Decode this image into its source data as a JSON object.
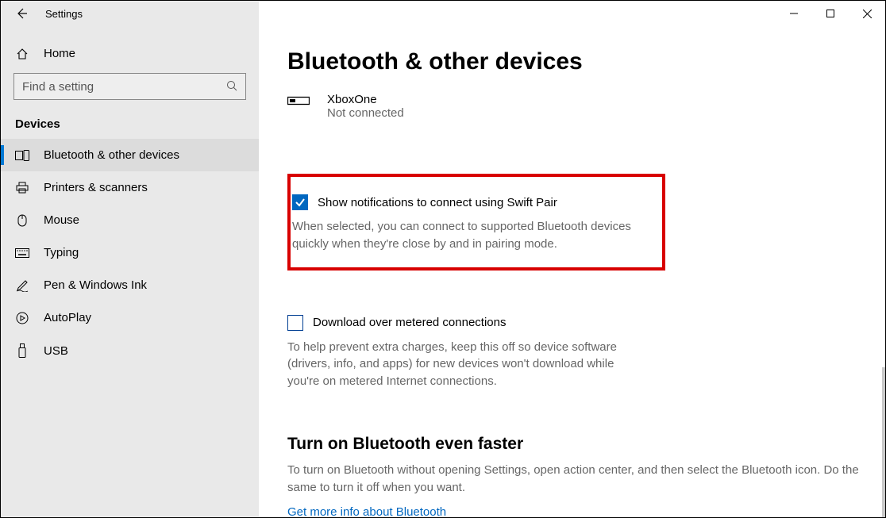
{
  "titlebar": {
    "title": "Settings"
  },
  "sidebar": {
    "home_label": "Home",
    "search_placeholder": "Find a setting",
    "section_label": "Devices",
    "items": [
      {
        "label": "Bluetooth & other devices"
      },
      {
        "label": "Printers & scanners"
      },
      {
        "label": "Mouse"
      },
      {
        "label": "Typing"
      },
      {
        "label": "Pen & Windows Ink"
      },
      {
        "label": "AutoPlay"
      },
      {
        "label": "USB"
      }
    ]
  },
  "content": {
    "page_title": "Bluetooth & other devices",
    "device": {
      "name": "XboxOne",
      "status": "Not connected"
    },
    "swift_pair": {
      "checked": true,
      "label": "Show notifications to connect using Swift Pair",
      "description": "When selected, you can connect to supported Bluetooth devices quickly when they're close by and in pairing mode."
    },
    "metered": {
      "checked": false,
      "label": "Download over metered connections",
      "description": "To help prevent extra charges, keep this off so device software (drivers, info, and apps) for new devices won't download while you're on metered Internet connections."
    },
    "faster": {
      "heading": "Turn on Bluetooth even faster",
      "description": "To turn on Bluetooth without opening Settings, open action center, and then select the Bluetooth icon. Do the same to turn it off when you want.",
      "link": "Get more info about Bluetooth"
    }
  }
}
